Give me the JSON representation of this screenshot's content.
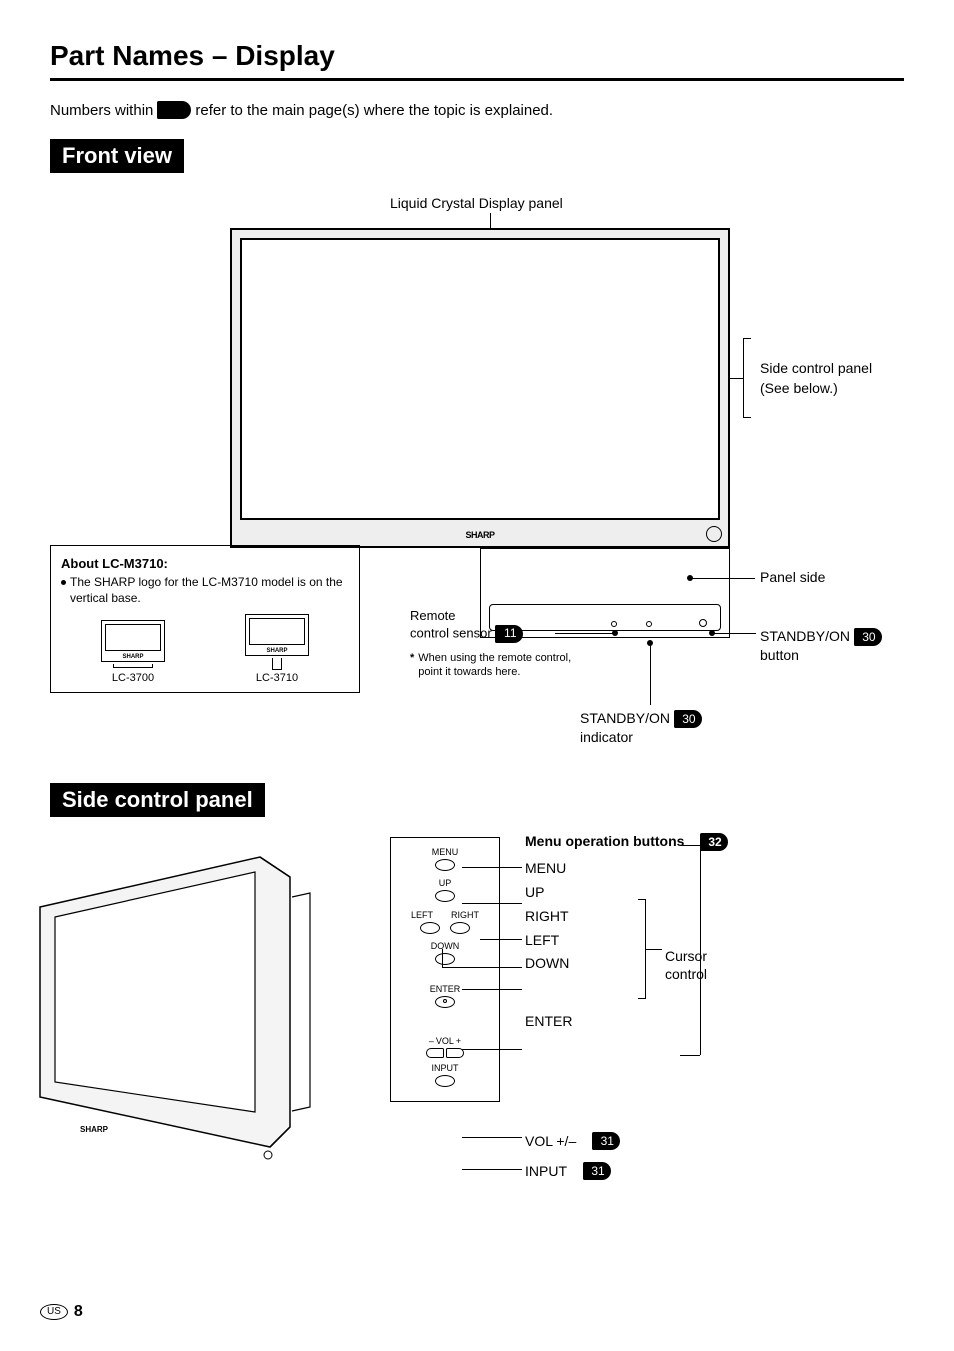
{
  "page": {
    "title": "Part Names – Display",
    "intro_pre": "Numbers within",
    "intro_post": "refer to the main page(s) where the topic is explained.",
    "region": "US",
    "number": "8"
  },
  "front": {
    "section": "Front view",
    "lcd_label": "Liquid Crystal Display panel",
    "brand": "SHARP",
    "side_panel": "Side control panel",
    "side_panel_sub": "(See below.)",
    "panel_side": "Panel side",
    "remote_l1": "Remote",
    "remote_l2": "control sensor",
    "remote_page": "11",
    "remote_note_star": "*",
    "remote_note": "When using the remote control, point it towards here.",
    "standby_button_l1": "STANDBY/ON",
    "standby_button_l2": "button",
    "standby_button_page": "30",
    "standby_ind_l1": "STANDBY/ON",
    "standby_ind_l2": "indicator",
    "standby_ind_page": "30"
  },
  "about": {
    "title": "About LC-M3710:",
    "text": "The SHARP logo for the LC-M3710 model is on the vertical base.",
    "model1": "LC-3700",
    "model2": "LC-3710"
  },
  "scp": {
    "section": "Side control panel",
    "menu_ops": "Menu operation buttons",
    "menu_ops_page": "32",
    "menu": "MENU",
    "up": "UP",
    "right": "RIGHT",
    "left": "LEFT",
    "down": "DOWN",
    "enter": "ENTER",
    "cursor_l1": "Cursor",
    "cursor_l2": "control",
    "vol": "VOL +/–",
    "vol_page": "31",
    "input": "INPUT",
    "input_page": "31",
    "panel_menu": "MENU",
    "panel_up": "UP",
    "panel_left": "LEFT",
    "panel_right": "RIGHT",
    "panel_down": "DOWN",
    "panel_enter": "ENTER",
    "panel_vol": "VOL",
    "panel_input": "INPUT"
  }
}
